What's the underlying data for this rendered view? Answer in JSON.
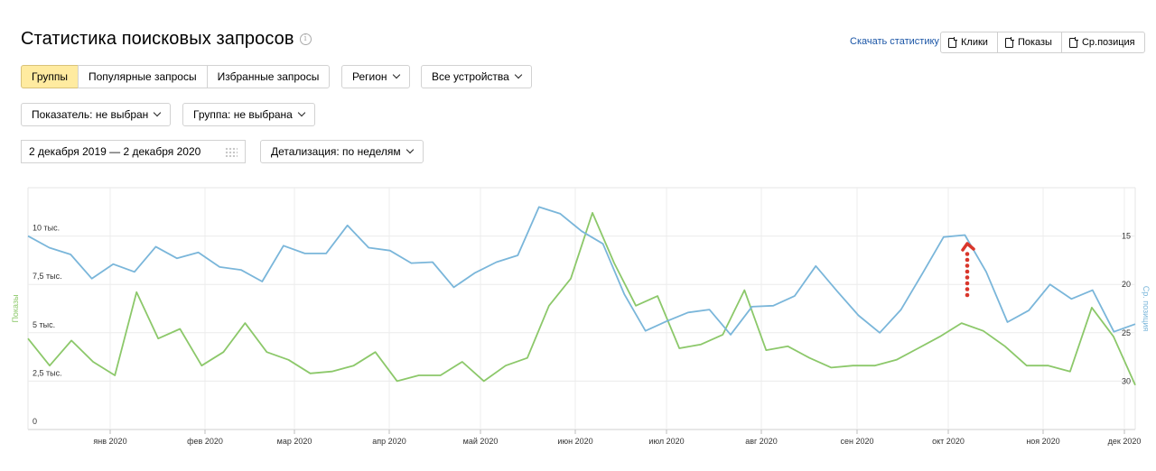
{
  "header": {
    "title": "Статистика поисковых запросов",
    "info_icon": "i",
    "download_label": "Скачать статистику",
    "export_buttons": [
      "Клики",
      "Показы",
      "Ср.позиция"
    ]
  },
  "tabs": [
    {
      "label": "Группы",
      "active": true
    },
    {
      "label": "Популярные запросы",
      "active": false
    },
    {
      "label": "Избранные запросы",
      "active": false
    }
  ],
  "filters": {
    "region": "Регион",
    "devices": "Все устройства",
    "metric": "Показатель: не выбран",
    "group": "Группа: не выбрана",
    "date_range": "2 декабря 2019 — 2 декабря 2020",
    "detail": "Детализация: по неделям"
  },
  "colors": {
    "impressions": "#8cc86a",
    "position": "#7ab6da",
    "annotation": "#d9362b",
    "active_tab": "#ffeba0",
    "link": "#1a55a6"
  },
  "chart_data": {
    "type": "line",
    "x_tick_labels": [
      "янв 2020",
      "фев 2020",
      "мар 2020",
      "апр 2020",
      "май 2020",
      "июн 2020",
      "июл 2020",
      "авг 2020",
      "сен 2020",
      "окт 2020",
      "ноя 2020",
      "дек 2020"
    ],
    "y_left": {
      "label": "Показы",
      "ticks": [
        "0",
        "2,5 тыс.",
        "5 тыс.",
        "7,5 тыс.",
        "10 тыс."
      ],
      "range": [
        0,
        12500
      ]
    },
    "y_right": {
      "label": "Ср. позиция",
      "ticks": [
        "15",
        "20",
        "25",
        "30"
      ],
      "range": [
        10,
        35
      ],
      "inverted": true
    },
    "series": [
      {
        "name": "Показы",
        "axis": "left",
        "values": [
          4700,
          3300,
          4600,
          3500,
          2800,
          7100,
          4700,
          5200,
          3300,
          4000,
          5500,
          4000,
          3600,
          2900,
          3000,
          3300,
          4000,
          2500,
          2800,
          2800,
          3500,
          2500,
          3300,
          3700,
          6400,
          7800,
          11200,
          8600,
          6400,
          6900,
          4200,
          4400,
          4900,
          7200,
          4100,
          4300,
          3700,
          3200,
          3300,
          3300,
          3600,
          4200,
          4800,
          5500,
          5100,
          4300,
          3300,
          3300,
          3000,
          6300,
          4800,
          2300
        ]
      },
      {
        "name": "Ср. позиция",
        "axis": "right",
        "values": [
          15.0,
          16.2,
          16.9,
          19.4,
          17.9,
          18.7,
          16.1,
          17.3,
          16.7,
          18.2,
          18.5,
          19.7,
          16.0,
          16.8,
          16.8,
          13.9,
          16.2,
          16.5,
          17.8,
          17.7,
          20.3,
          18.8,
          17.7,
          17.0,
          12.0,
          12.7,
          14.5,
          15.8,
          21.0,
          24.8,
          23.8,
          22.9,
          22.6,
          25.2,
          22.3,
          22.2,
          21.2,
          18.1,
          20.7,
          23.2,
          25.0,
          22.6,
          18.9,
          15.1,
          14.9,
          18.7,
          23.9,
          22.7,
          20.0,
          21.5,
          20.6,
          24.9,
          24.1
        ]
      }
    ],
    "annotation": "dotted arrow pointing up"
  }
}
